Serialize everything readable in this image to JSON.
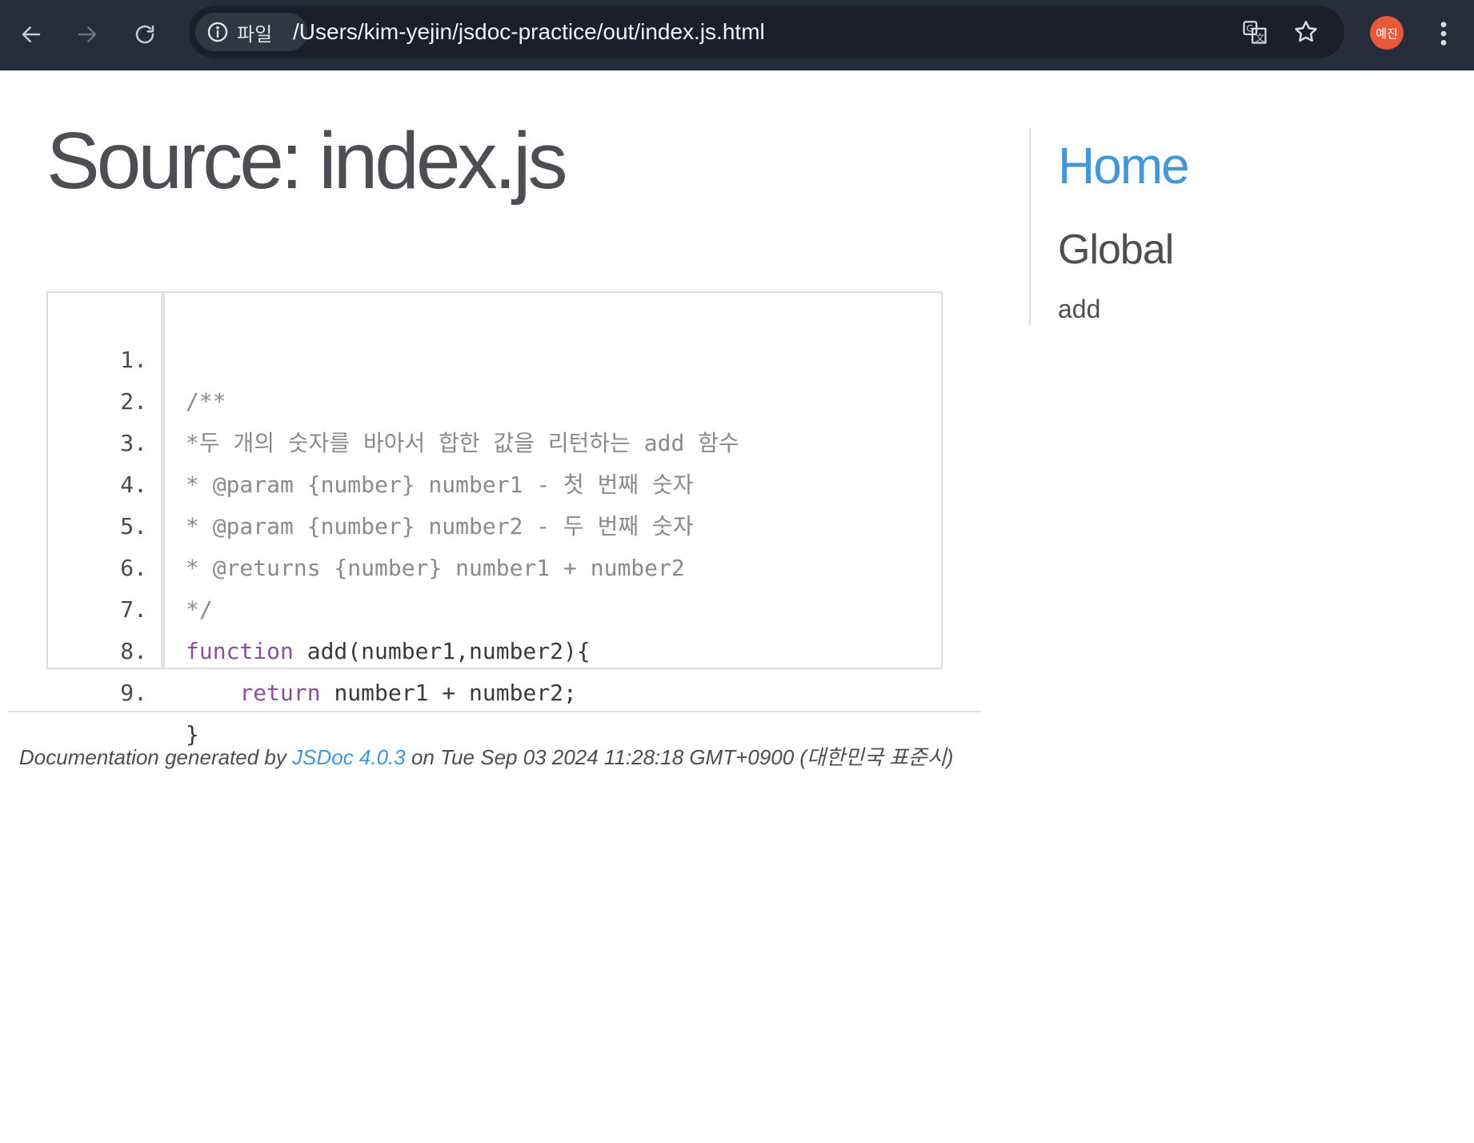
{
  "browser": {
    "site_chip_label": "파일",
    "url": "/Users/kim-yejin/jsdoc-practice/out/index.js.html",
    "profile_label": "예진"
  },
  "page": {
    "title": "Source: index.js"
  },
  "source": {
    "lines": [
      {
        "num": "1.",
        "code": "/**"
      },
      {
        "num": "2.",
        "code": "*두 개의 숫자를 바아서 합한 값을 리턴하는 add 함수"
      },
      {
        "num": "3.",
        "code": "* @param {number} number1 - 첫 번째 숫자"
      },
      {
        "num": "4.",
        "code": "* @param {number} number2 - 두 번째 숫자"
      },
      {
        "num": "5.",
        "code": "* @returns {number} number1 + number2"
      },
      {
        "num": "6.",
        "code": "*/"
      },
      {
        "num": "7.",
        "keyword": "function",
        "rest": " add(number1,number2){"
      },
      {
        "num": "8.",
        "indent": "    ",
        "keyword": "return",
        "rest": " number1 + number2;"
      },
      {
        "num": "9.",
        "code": "}"
      }
    ]
  },
  "nav": {
    "home": "Home",
    "section": "Global",
    "items": [
      {
        "label": "add"
      }
    ]
  },
  "footer": {
    "prefix": "Documentation generated by ",
    "link": "JSDoc 4.0.3",
    "suffix": " on Tue Sep 03 2024 11:28:18 GMT+0900 (대한민국 표준시)"
  },
  "colors": {
    "chrome_bg": "#272c3a",
    "link": "#4197d8",
    "keyword": "#8b4fa0",
    "comment": "#8a8a8a",
    "avatar": "#e8583a"
  }
}
